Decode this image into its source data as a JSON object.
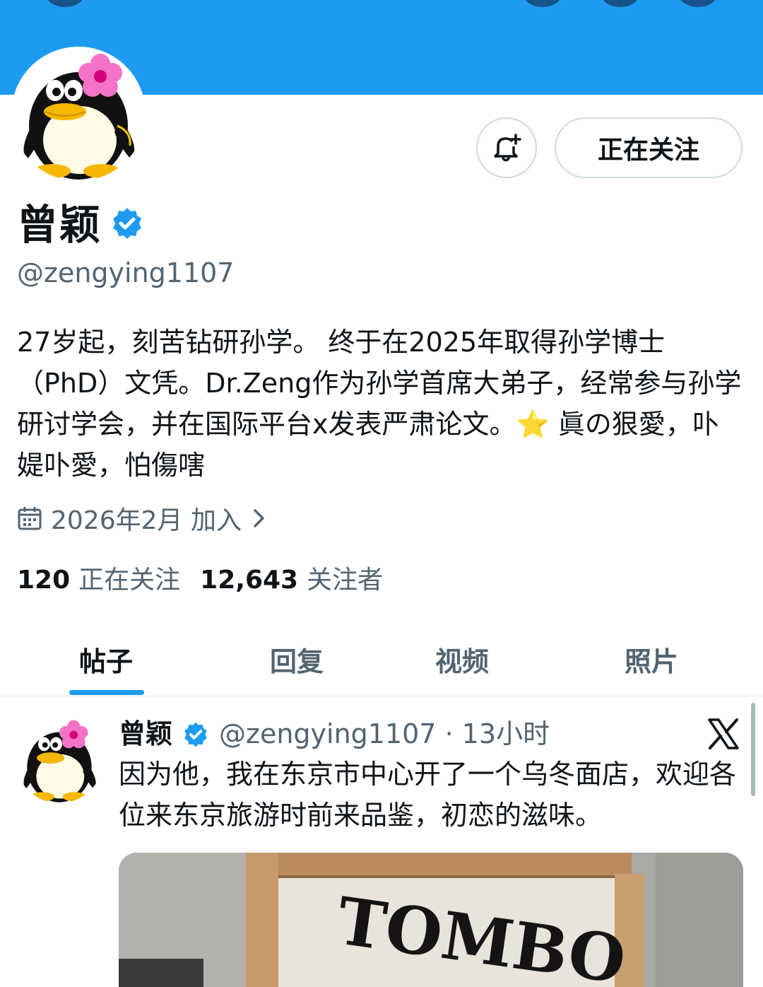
{
  "profile": {
    "display_name": "曾颖",
    "handle": "@zengying1107",
    "bio": "27岁起，刻苦钻研孙学。 终于在2025年取得孙学博士（PhD）文凭。Dr.Zeng作为孙学首席大弟子，经常参与孙学研讨学会，并在国际平台x发表严肃论文。⭐ 眞の狠愛，卟媞卟愛，怕傷嗐",
    "joined": "2026年2月 加入",
    "following_count": "120",
    "following_label": "正在关注",
    "followers_count": "12,643",
    "followers_label": "关注者"
  },
  "actions": {
    "follow_label": "正在关注"
  },
  "tabs": [
    {
      "label": "帖子",
      "active": true
    },
    {
      "label": "回复",
      "active": false
    },
    {
      "label": "视频",
      "active": false
    },
    {
      "label": "照片",
      "active": false
    }
  ],
  "post": {
    "author": "曾颖",
    "meta": "@zengying1107 · 13小时",
    "text": "因为他，我在东京市中心开了一个乌冬面店，欢迎各位来东京旅游时前来品鉴，初恋的滋味。",
    "image_sign": "TOMBO"
  },
  "colors": {
    "accent": "#1d9bf0",
    "text_primary": "#0f1419",
    "text_secondary": "#536471"
  }
}
